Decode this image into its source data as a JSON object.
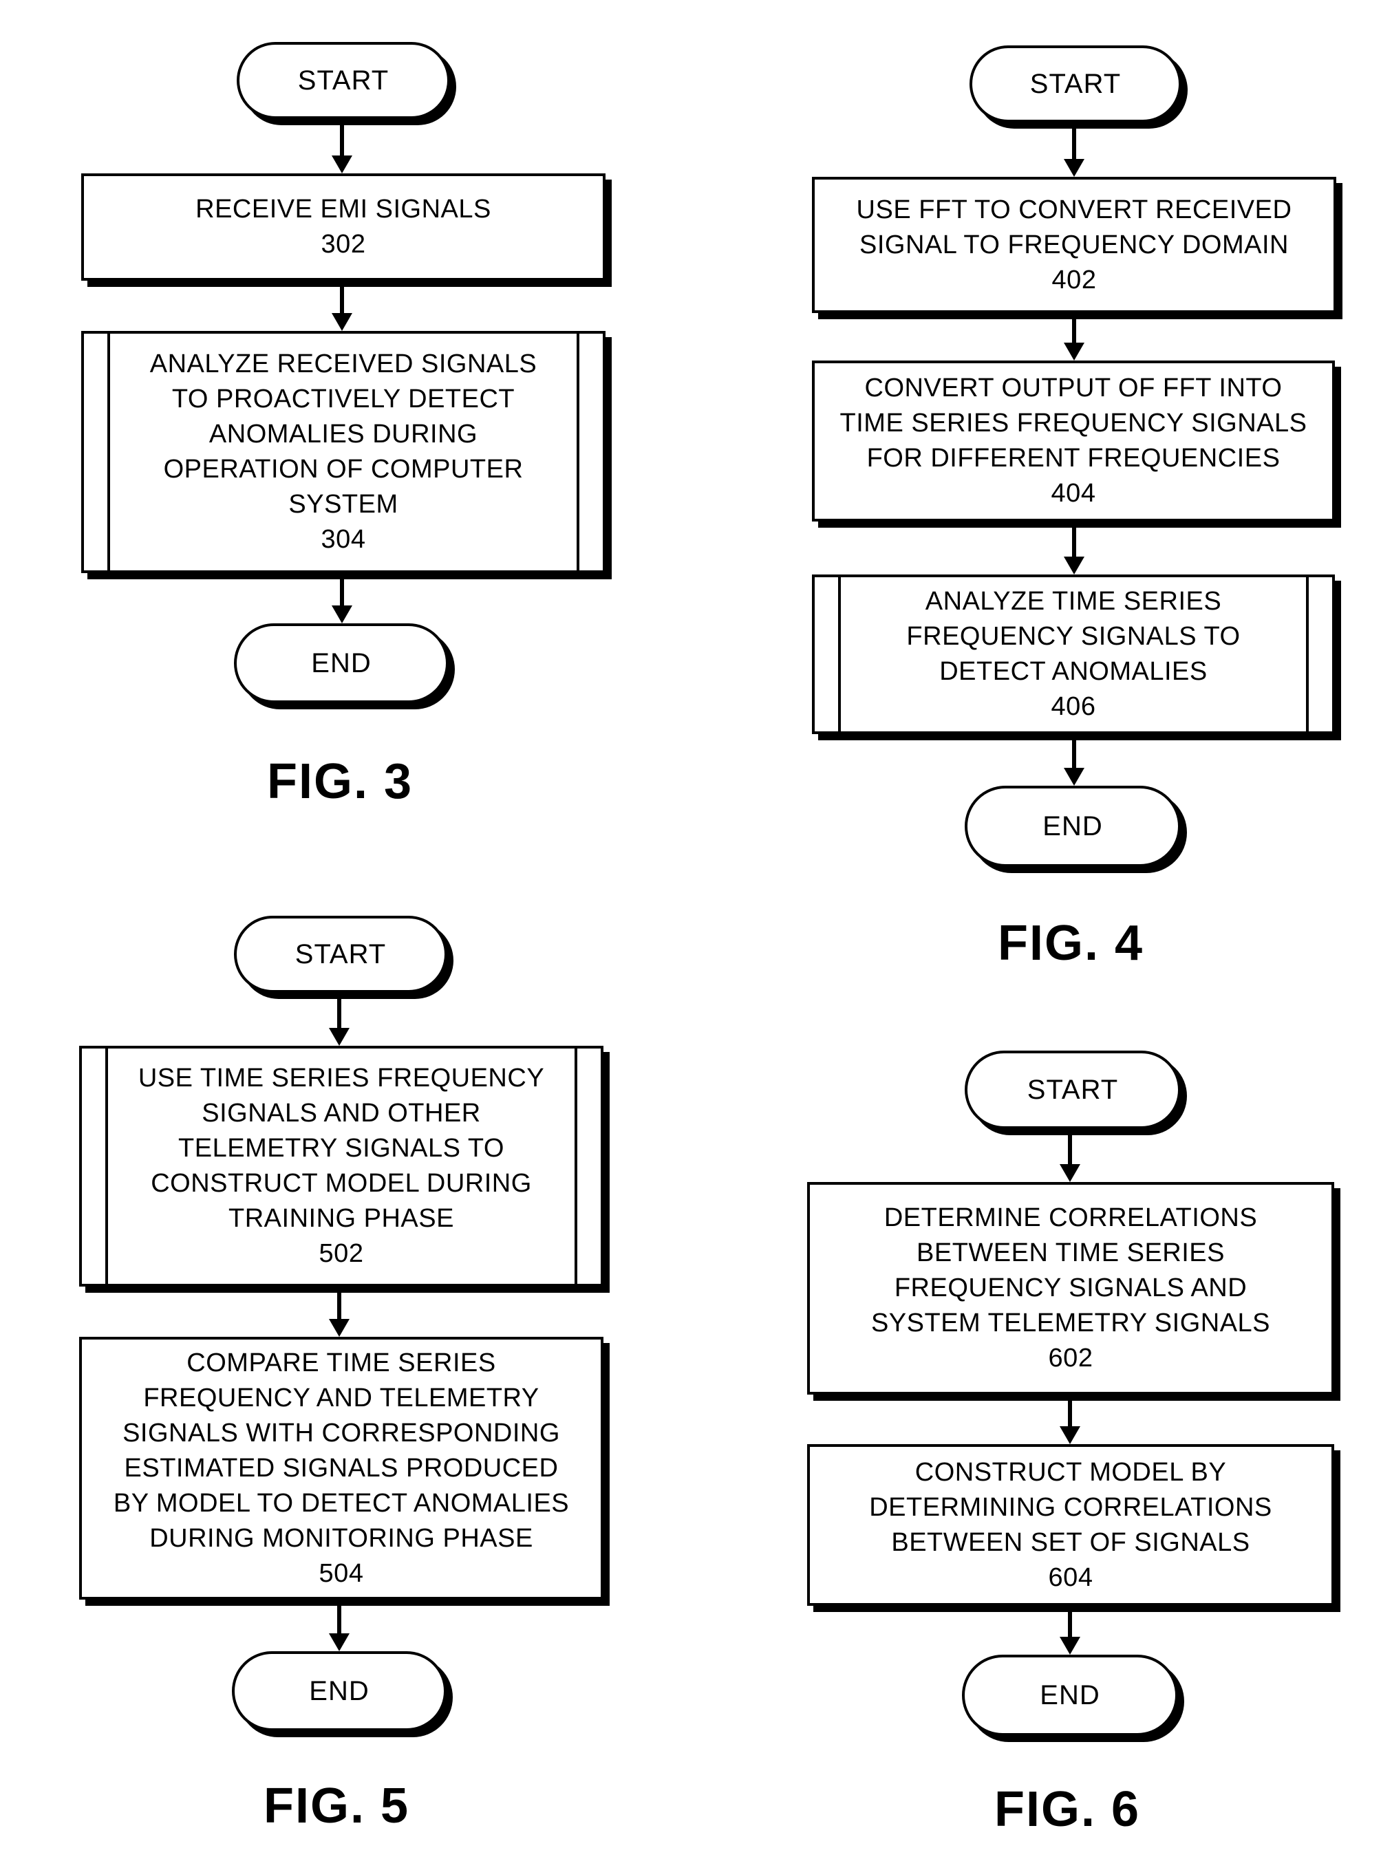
{
  "figures": [
    {
      "label": "FIG. 3",
      "start": "START",
      "end": "END",
      "steps": [
        {
          "lines": [
            "RECEIVE EMI SIGNALS"
          ],
          "ref": "302",
          "type": "process"
        },
        {
          "lines": [
            "ANALYZE RECEIVED SIGNALS",
            "TO PROACTIVELY DETECT",
            "ANOMALIES DURING",
            "OPERATION OF COMPUTER",
            "SYSTEM"
          ],
          "ref": "304",
          "type": "predefined"
        }
      ]
    },
    {
      "label": "FIG. 4",
      "start": "START",
      "end": "END",
      "steps": [
        {
          "lines": [
            "USE FFT TO CONVERT RECEIVED",
            "SIGNAL TO FREQUENCY DOMAIN"
          ],
          "ref": "402",
          "type": "process"
        },
        {
          "lines": [
            "CONVERT OUTPUT OF FFT INTO",
            "TIME SERIES FREQUENCY SIGNALS",
            "FOR DIFFERENT FREQUENCIES"
          ],
          "ref": "404",
          "type": "process"
        },
        {
          "lines": [
            "ANALYZE TIME SERIES",
            "FREQUENCY SIGNALS TO",
            "DETECT ANOMALIES"
          ],
          "ref": "406",
          "type": "predefined"
        }
      ]
    },
    {
      "label": "FIG. 5",
      "start": "START",
      "end": "END",
      "steps": [
        {
          "lines": [
            "USE TIME SERIES FREQUENCY",
            "SIGNALS AND OTHER",
            "TELEMETRY SIGNALS TO",
            "CONSTRUCT MODEL DURING",
            "TRAINING PHASE"
          ],
          "ref": "502",
          "type": "predefined"
        },
        {
          "lines": [
            "COMPARE TIME SERIES",
            "FREQUENCY AND TELEMETRY",
            "SIGNALS WITH CORRESPONDING",
            "ESTIMATED SIGNALS PRODUCED",
            "BY MODEL TO DETECT ANOMALIES",
            "DURING MONITORING PHASE"
          ],
          "ref": "504",
          "type": "process"
        }
      ]
    },
    {
      "label": "FIG. 6",
      "start": "START",
      "end": "END",
      "steps": [
        {
          "lines": [
            "DETERMINE CORRELATIONS",
            "BETWEEN TIME SERIES",
            "FREQUENCY SIGNALS AND",
            "SYSTEM TELEMETRY SIGNALS"
          ],
          "ref": "602",
          "type": "process"
        },
        {
          "lines": [
            "CONSTRUCT MODEL BY",
            "DETERMINING CORRELATIONS",
            "BETWEEN SET OF SIGNALS"
          ],
          "ref": "604",
          "type": "process"
        }
      ]
    }
  ]
}
